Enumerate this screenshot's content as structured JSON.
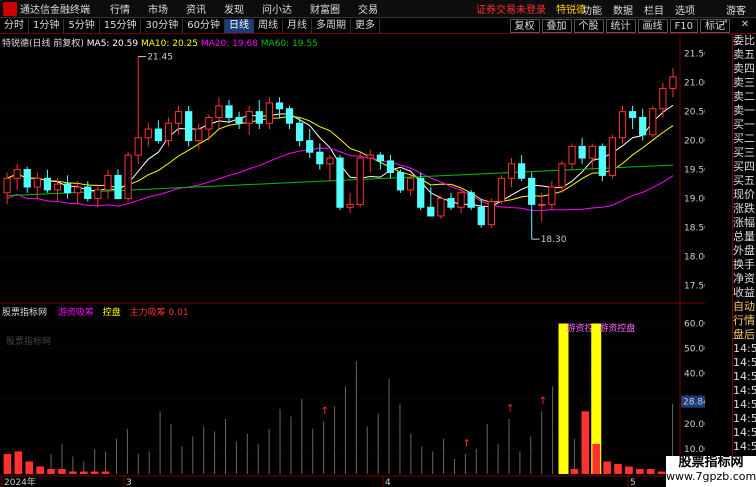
{
  "menubar": {
    "app_title": "通达信金融终端",
    "items": [
      "行情",
      "市场",
      "资讯",
      "发现",
      "问小达",
      "财富圈",
      "交易"
    ],
    "login_status": "证券交易未登录",
    "stock_name": "特锐德",
    "right_items": [
      "功能",
      "数据",
      "栏目",
      "选项",
      "游客"
    ]
  },
  "toolbar": {
    "periods": [
      "分时",
      "1分钟",
      "5分钟",
      "15分钟",
      "30分钟",
      "60分钟",
      "日线",
      "周线",
      "月线",
      "多周期",
      "更多"
    ],
    "active": "日线",
    "right_buttons": [
      "复权",
      "叠加",
      "个股",
      "统计",
      "画线",
      "F10",
      "标记"
    ]
  },
  "main_legend": {
    "title": "特锐德(日线 前复权)",
    "ma5": "MA5: 20.59",
    "ma10": "MA10: 20.25",
    "ma20": "MA20: 19.68",
    "ma60": "MA60: 19.55"
  },
  "price_axis": [
    "21.50",
    "21.00",
    "20.50",
    "20.00",
    "19.50",
    "19.00",
    "18.50",
    "18.00",
    "17.50"
  ],
  "annotations": {
    "high": "21.45",
    "low": "18.30"
  },
  "indicator_legend": {
    "name": "股票指标网",
    "s1": "游资吸筹",
    "s2": "控盘",
    "s3": "主力吸筹 0.01",
    "watermark": "股票指标网"
  },
  "indicator_axis": [
    "60.00",
    "50.00",
    "40.00",
    "30.00",
    "20.00",
    "10.00"
  ],
  "indicator_current": "28.84",
  "bar_labels": [
    "游资控盘",
    "游资控盘"
  ],
  "date_axis": [
    "2024年",
    "3",
    "4",
    "5"
  ],
  "right_panel": [
    "委比",
    "卖五",
    "卖四",
    "卖三",
    "卖二",
    "卖一",
    "买一",
    "买二",
    "买三",
    "买四",
    "买五",
    "现价",
    "涨跌",
    "涨幅",
    "总量",
    "外盘",
    "换手",
    "净资",
    "收益",
    "自动",
    "行情",
    "盘后",
    "14:50",
    "14:50",
    "14:50",
    "14:50",
    "14:50",
    "14:50",
    "14:50",
    "14:50"
  ],
  "right_top": "+自选",
  "right_back": "返回",
  "site": {
    "line1": "股票指标网",
    "line2": "www.7gpzb.com"
  },
  "colors": {
    "up": "#ff3232",
    "down": "#54ffff",
    "ma5": "#ffffff",
    "ma10": "#ffff00",
    "ma20": "#ff00ff",
    "ma60": "#00c000",
    "signal": "#ffff00"
  },
  "chart_data": {
    "type": "candlestick",
    "candles": [
      {
        "o": 19.1,
        "h": 19.45,
        "l": 18.9,
        "c": 19.35
      },
      {
        "o": 19.35,
        "h": 19.6,
        "l": 19.15,
        "c": 19.5
      },
      {
        "o": 19.5,
        "h": 19.55,
        "l": 19.1,
        "c": 19.2
      },
      {
        "o": 19.2,
        "h": 19.45,
        "l": 19.0,
        "c": 19.35
      },
      {
        "o": 19.35,
        "h": 19.5,
        "l": 19.1,
        "c": 19.15
      },
      {
        "o": 19.15,
        "h": 19.35,
        "l": 18.95,
        "c": 19.25
      },
      {
        "o": 19.25,
        "h": 19.4,
        "l": 19.0,
        "c": 19.1
      },
      {
        "o": 19.1,
        "h": 19.3,
        "l": 18.9,
        "c": 19.2
      },
      {
        "o": 19.2,
        "h": 19.3,
        "l": 18.95,
        "c": 19.0
      },
      {
        "o": 19.0,
        "h": 19.25,
        "l": 18.85,
        "c": 19.15
      },
      {
        "o": 19.15,
        "h": 19.5,
        "l": 19.0,
        "c": 19.4
      },
      {
        "o": 19.4,
        "h": 19.5,
        "l": 19.0,
        "c": 19.0
      },
      {
        "o": 19.0,
        "h": 19.8,
        "l": 18.95,
        "c": 19.75
      },
      {
        "o": 19.75,
        "h": 21.45,
        "l": 19.6,
        "c": 20.05
      },
      {
        "o": 20.05,
        "h": 20.3,
        "l": 19.9,
        "c": 20.2
      },
      {
        "o": 20.2,
        "h": 20.35,
        "l": 19.95,
        "c": 20.0
      },
      {
        "o": 20.0,
        "h": 20.4,
        "l": 19.9,
        "c": 20.3
      },
      {
        "o": 20.3,
        "h": 20.6,
        "l": 20.1,
        "c": 20.5
      },
      {
        "o": 20.5,
        "h": 20.6,
        "l": 19.9,
        "c": 20.0
      },
      {
        "o": 20.0,
        "h": 20.3,
        "l": 19.85,
        "c": 20.2
      },
      {
        "o": 20.2,
        "h": 20.45,
        "l": 20.0,
        "c": 20.4
      },
      {
        "o": 20.4,
        "h": 20.75,
        "l": 20.2,
        "c": 20.6
      },
      {
        "o": 20.6,
        "h": 20.7,
        "l": 20.3,
        "c": 20.4
      },
      {
        "o": 20.4,
        "h": 20.5,
        "l": 20.2,
        "c": 20.3
      },
      {
        "o": 20.3,
        "h": 20.6,
        "l": 20.1,
        "c": 20.5
      },
      {
        "o": 20.5,
        "h": 20.7,
        "l": 20.2,
        "c": 20.3
      },
      {
        "o": 20.3,
        "h": 20.75,
        "l": 20.2,
        "c": 20.65
      },
      {
        "o": 20.65,
        "h": 20.75,
        "l": 20.4,
        "c": 20.55
      },
      {
        "o": 20.55,
        "h": 20.6,
        "l": 20.2,
        "c": 20.3
      },
      {
        "o": 20.3,
        "h": 20.4,
        "l": 19.9,
        "c": 20.0
      },
      {
        "o": 20.0,
        "h": 20.2,
        "l": 19.7,
        "c": 19.8
      },
      {
        "o": 19.8,
        "h": 19.95,
        "l": 19.5,
        "c": 19.6
      },
      {
        "o": 19.6,
        "h": 19.75,
        "l": 19.3,
        "c": 19.7
      },
      {
        "o": 19.7,
        "h": 19.75,
        "l": 18.8,
        "c": 18.85
      },
      {
        "o": 18.85,
        "h": 19.1,
        "l": 18.75,
        "c": 18.9
      },
      {
        "o": 18.9,
        "h": 19.8,
        "l": 18.85,
        "c": 19.7
      },
      {
        "o": 19.7,
        "h": 19.85,
        "l": 19.45,
        "c": 19.75
      },
      {
        "o": 19.75,
        "h": 19.8,
        "l": 19.5,
        "c": 19.65
      },
      {
        "o": 19.65,
        "h": 19.75,
        "l": 19.35,
        "c": 19.45
      },
      {
        "o": 19.45,
        "h": 19.5,
        "l": 19.1,
        "c": 19.15
      },
      {
        "o": 19.15,
        "h": 19.4,
        "l": 19.05,
        "c": 19.35
      },
      {
        "o": 19.35,
        "h": 19.45,
        "l": 18.8,
        "c": 18.85
      },
      {
        "o": 18.85,
        "h": 19.2,
        "l": 18.7,
        "c": 18.7
      },
      {
        "o": 18.7,
        "h": 19.05,
        "l": 18.65,
        "c": 19.0
      },
      {
        "o": 19.0,
        "h": 19.1,
        "l": 18.8,
        "c": 18.85
      },
      {
        "o": 18.85,
        "h": 19.2,
        "l": 18.75,
        "c": 19.1
      },
      {
        "o": 19.1,
        "h": 19.15,
        "l": 18.8,
        "c": 18.85
      },
      {
        "o": 18.85,
        "h": 19.0,
        "l": 18.5,
        "c": 18.55
      },
      {
        "o": 18.55,
        "h": 19.0,
        "l": 18.5,
        "c": 18.95
      },
      {
        "o": 18.95,
        "h": 19.4,
        "l": 18.9,
        "c": 19.35
      },
      {
        "o": 19.35,
        "h": 19.7,
        "l": 19.2,
        "c": 19.6
      },
      {
        "o": 19.6,
        "h": 19.75,
        "l": 19.3,
        "c": 19.35
      },
      {
        "o": 19.35,
        "h": 19.45,
        "l": 18.3,
        "c": 18.9
      },
      {
        "o": 18.9,
        "h": 19.1,
        "l": 18.6,
        "c": 18.9
      },
      {
        "o": 18.9,
        "h": 19.3,
        "l": 18.8,
        "c": 19.2
      },
      {
        "o": 19.2,
        "h": 19.65,
        "l": 19.1,
        "c": 19.6
      },
      {
        "o": 19.6,
        "h": 19.95,
        "l": 19.5,
        "c": 19.9
      },
      {
        "o": 19.9,
        "h": 20.05,
        "l": 19.6,
        "c": 19.7
      },
      {
        "o": 19.7,
        "h": 19.95,
        "l": 19.5,
        "c": 19.9
      },
      {
        "o": 19.9,
        "h": 19.95,
        "l": 19.3,
        "c": 19.4
      },
      {
        "o": 19.4,
        "h": 20.1,
        "l": 19.35,
        "c": 20.05
      },
      {
        "o": 20.05,
        "h": 20.6,
        "l": 19.95,
        "c": 20.5
      },
      {
        "o": 20.5,
        "h": 20.6,
        "l": 20.2,
        "c": 20.4
      },
      {
        "o": 20.4,
        "h": 20.55,
        "l": 20.0,
        "c": 20.1
      },
      {
        "o": 20.1,
        "h": 20.6,
        "l": 20.05,
        "c": 20.55
      },
      {
        "o": 20.55,
        "h": 21.0,
        "l": 20.4,
        "c": 20.9
      },
      {
        "o": 20.9,
        "h": 21.25,
        "l": 20.75,
        "c": 21.1
      }
    ],
    "indicator_grey": [
      5,
      6,
      4,
      3,
      8,
      12,
      7,
      5,
      10,
      9,
      14,
      18,
      8,
      9,
      25,
      20,
      11,
      15,
      19,
      17,
      22,
      13,
      16,
      12,
      18,
      26,
      23,
      30,
      18,
      21,
      27,
      35,
      45,
      19,
      24,
      38,
      28,
      16,
      11,
      9,
      14,
      6,
      8,
      10,
      20,
      12,
      22,
      9,
      15,
      25,
      35,
      17,
      14,
      12,
      4,
      3,
      2,
      2,
      1,
      2,
      1,
      28
    ],
    "indicator_red": [
      8,
      9,
      5,
      3,
      2,
      2,
      1,
      1,
      1,
      1,
      0,
      0,
      0,
      0,
      0,
      0,
      0,
      0,
      0,
      0,
      0,
      0,
      0,
      0,
      0,
      0,
      0,
      0,
      0,
      0,
      0,
      0,
      0,
      0,
      0,
      0,
      0,
      0,
      0,
      0,
      0,
      0,
      0,
      0,
      0,
      0,
      0,
      0,
      0,
      0,
      0,
      0,
      2,
      25,
      12,
      5,
      4,
      3,
      2,
      2,
      1,
      0
    ],
    "signal_index": [
      51,
      54
    ],
    "arrow_index": [
      29,
      42,
      46,
      49
    ]
  }
}
